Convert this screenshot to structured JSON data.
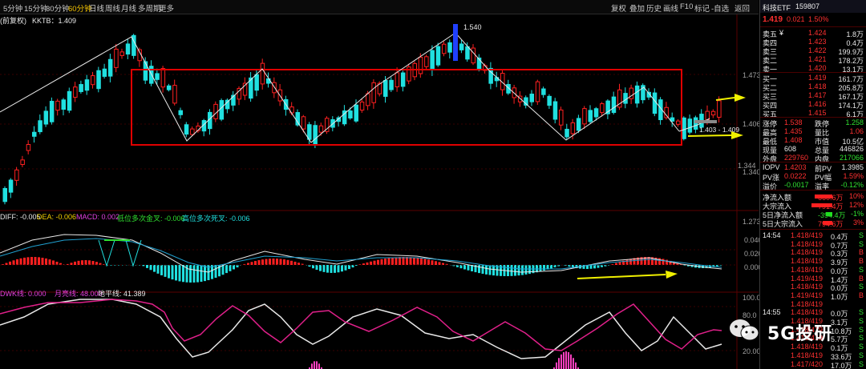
{
  "toolbar": {
    "periods": [
      "5分钟",
      "15分钟",
      "30分钟",
      "60分钟",
      "日线",
      "周线",
      "月线",
      "多周期",
      "更多"
    ],
    "active_period": "60分钟",
    "tools": [
      "复权",
      "叠加",
      "历史",
      "画线",
      "F10",
      "标记",
      "-自选",
      "返回"
    ]
  },
  "main_legend": {
    "prefix": "(前复权)",
    "kktb": "KKTB：1.409"
  },
  "price_axis": {
    "p1": "1.473",
    "p2": "1.406",
    "p3": "1.344",
    "p4": "1.340",
    "p5": "1.273"
  },
  "annotations": {
    "high_price": "1.540",
    "low_range": "1.403 - 1.409"
  },
  "macd_legend": {
    "dif": "DIFF: -0.005",
    "dea": "DEA: -0.006",
    "macd": "MACD: 0.002",
    "low_cross": "低位多次金叉: -0.006",
    "high_cross": "高位多次死叉: -0.006"
  },
  "macd_axis": {
    "a1": "0.040",
    "a2": "0.020",
    "a3": "0.000"
  },
  "kdj_legend": {
    "l1": "DWK线: 0.000",
    "l2": "月亮线: 48.000",
    "l3": "地平线: 41.389"
  },
  "kdj_axis": {
    "a1": "100.0",
    "a2": "80.0",
    "a3": "20.00"
  },
  "side": {
    "title": "科技ETF",
    "code": "159807",
    "price": "1.419",
    "change": "0.021",
    "pct": "1.50%",
    "asks": [
      {
        "label": "卖五",
        "mark": "¥",
        "price": "1.424",
        "vol": "1.8万"
      },
      {
        "label": "卖四",
        "mark": "",
        "price": "1.423",
        "vol": "0.4万"
      },
      {
        "label": "卖三",
        "mark": "",
        "price": "1.422",
        "vol": "199.9万"
      },
      {
        "label": "卖二",
        "mark": "",
        "price": "1.421",
        "vol": "178.2万"
      },
      {
        "label": "卖一",
        "mark": "",
        "price": "1.420",
        "vol": "13.1万"
      }
    ],
    "bids": [
      {
        "label": "买一",
        "price": "1.419",
        "vol": "161.7万"
      },
      {
        "label": "买二",
        "price": "1.418",
        "vol": "205.8万"
      },
      {
        "label": "买三",
        "price": "1.417",
        "vol": "167.1万"
      },
      {
        "label": "买四",
        "price": "1.416",
        "vol": "174.1万"
      },
      {
        "label": "买五",
        "price": "1.415",
        "vol": "6.1万"
      }
    ],
    "stats": [
      {
        "l1": "涨停",
        "v1": "1.538",
        "l2": "跌停",
        "v2": "1.258",
        "c1": "red",
        "c2": "green"
      },
      {
        "l1": "最高",
        "v1": "1.435",
        "l2": "量比",
        "v2": "1.06",
        "c1": "red",
        "c2": "red"
      },
      {
        "l1": "最低",
        "v1": "1.408",
        "l2": "市值",
        "v2": "10.5亿",
        "c1": "red",
        "c2": "white"
      },
      {
        "l1": "现量",
        "v1": "608",
        "l2": "总量",
        "v2": "446826",
        "c1": "white",
        "c2": "white"
      },
      {
        "l1": "外盘",
        "v1": "229760",
        "l2": "内盘",
        "v2": "217066",
        "c1": "red",
        "c2": "green"
      }
    ],
    "stats2": [
      {
        "l1": "IOPV",
        "v1": "1.4203",
        "l2": "前PV",
        "v2": "1.3985",
        "c1": "red",
        "c2": "white"
      },
      {
        "l1": "PV涨",
        "v1": "0.0222",
        "l2": "PV幅",
        "v2": "1.59%",
        "c1": "red",
        "c2": "red"
      },
      {
        "l1": "溢价",
        "v1": "-0.0017",
        "l2": "溢率",
        "v2": "-0.12%",
        "c1": "green",
        "c2": "green"
      }
    ],
    "flows": [
      {
        "label": "净流入额",
        "val": "660.6万",
        "pct": "10%",
        "color": "red",
        "barw": 22,
        "barx": 70
      },
      {
        "label": "大宗流入",
        "val": "791.4万",
        "pct": "12%",
        "color": "red",
        "barw": 26,
        "barx": 70
      },
      {
        "label": "5日净流入额",
        "val": "-394.4万",
        "pct": "-1%",
        "color": "green",
        "barw": 8,
        "barx": 70
      },
      {
        "label": "5日大宗流入",
        "val": "794.6万",
        "pct": "3%",
        "color": "red",
        "barw": 12,
        "barx": 70
      }
    ],
    "ticks": [
      {
        "time": "14:54",
        "price": "1.418/419",
        "vol": "0.4万",
        "bs": "S",
        "pc": "red",
        "bc": "green"
      },
      {
        "time": "",
        "price": "1.418/419",
        "vol": "0.7万",
        "bs": "S",
        "pc": "red",
        "bc": "green"
      },
      {
        "time": "",
        "price": "1.418/419",
        "vol": "0.3万",
        "bs": "B",
        "pc": "red",
        "bc": "red"
      },
      {
        "time": "",
        "price": "1.418/419",
        "vol": "3.9万",
        "bs": "B",
        "pc": "red",
        "bc": "red"
      },
      {
        "time": "",
        "price": "1.418/419",
        "vol": "0.0万",
        "bs": "S",
        "pc": "red",
        "bc": "green"
      },
      {
        "time": "",
        "price": "1.419/419",
        "vol": "1.4万",
        "bs": "B",
        "pc": "red",
        "bc": "red"
      },
      {
        "time": "",
        "price": "1.418/419",
        "vol": "0.0万",
        "bs": "S",
        "pc": "red",
        "bc": "green"
      },
      {
        "time": "",
        "price": "1.419/419",
        "vol": "1.0万",
        "bs": "B",
        "pc": "red",
        "bc": "red"
      },
      {
        "time": "",
        "price": "1.418/419",
        "vol": "",
        "bs": "",
        "pc": "red",
        "bc": "red"
      },
      {
        "time": "14:55",
        "price": "1.418/419",
        "vol": "0.0万",
        "bs": "S",
        "pc": "red",
        "bc": "green"
      },
      {
        "time": "",
        "price": "1.418/419",
        "vol": "3.1万",
        "bs": "S",
        "pc": "red",
        "bc": "green"
      },
      {
        "time": "",
        "price": "1.418/419",
        "vol": "10.8万",
        "bs": "S",
        "pc": "red",
        "bc": "green"
      },
      {
        "time": "",
        "price": "1.418/419",
        "vol": "5.7万",
        "bs": "S",
        "pc": "red",
        "bc": "green"
      },
      {
        "time": "",
        "price": "1.418/419",
        "vol": "0.1万",
        "bs": "S",
        "pc": "red",
        "bc": "green"
      },
      {
        "time": "",
        "price": "1.418/419",
        "vol": "33.6万",
        "bs": "S",
        "pc": "red",
        "bc": "green"
      },
      {
        "time": "",
        "price": "1.417/420",
        "vol": "17.0万",
        "bs": "S",
        "pc": "red",
        "bc": "green"
      }
    ]
  },
  "watermark": {
    "text": "5G投研"
  },
  "colors": {
    "up": "#ff2020",
    "down": "#20e0e0",
    "box": "#e00000",
    "arrow": "#f0f000"
  }
}
